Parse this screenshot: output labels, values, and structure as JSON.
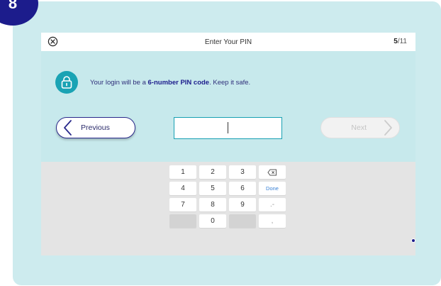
{
  "step_badge": "8",
  "topbar": {
    "title": "Enter Your PIN",
    "step_current": "5",
    "step_total": "/11",
    "close_icon": "close-circle-icon"
  },
  "info": {
    "icon": "lock-icon",
    "text_before": "Your login will be a ",
    "text_strong": "6-number PIN code",
    "text_after": ". Keep it safe."
  },
  "navigation": {
    "previous_label": "Previous",
    "next_label": "Next",
    "next_enabled": false
  },
  "pin_input": {
    "value": ""
  },
  "keypad": {
    "row1": [
      "1",
      "2",
      "3",
      "backspace-icon"
    ],
    "row2": [
      "4",
      "5",
      "6",
      "Done"
    ],
    "row3": [
      "7",
      "8",
      "9",
      ".-"
    ],
    "row4": [
      "",
      "0",
      "",
      ","
    ]
  },
  "colors": {
    "accent": "#1c1c8c",
    "teal": "#18a0b3",
    "panel_background": "#c7e9ec",
    "keyboard_background": "#e4e4e4"
  }
}
